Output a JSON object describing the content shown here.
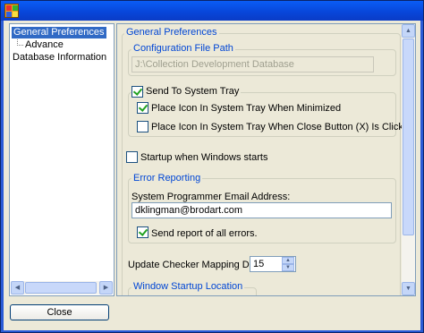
{
  "window": {
    "title": ""
  },
  "tree": {
    "items": [
      "General Preferences",
      "Advance",
      "Database Information"
    ]
  },
  "buttons": {
    "close": "Close"
  },
  "general": {
    "group_title": "General Preferences",
    "config": {
      "title": "Configuration File Path",
      "value": "J:\\Collection Development Database"
    },
    "tray": {
      "label": "Send To System Tray",
      "checked": true,
      "minimized_label": "Place Icon In System Tray When Minimized",
      "minimized_checked": true,
      "close_label": "Place Icon In System Tray When Close Button (X) Is Clicked",
      "close_checked": false
    },
    "startup": {
      "label": "Startup when Windows starts",
      "checked": false
    },
    "error": {
      "title": "Error Reporting",
      "email_label": "System Programmer Email Address:",
      "email_value": "dklingman@brodart.com",
      "send_label": "Send report of all errors.",
      "send_checked": true
    },
    "mapping": {
      "label": "Update Checker Mapping Delay:",
      "value": "15"
    },
    "startup_location": {
      "title": "Window Startup Location"
    }
  },
  "colors": {
    "titlebar": "#0a5df5",
    "accent": "#0046d5",
    "selection": "#316ac5",
    "face": "#ece9d8"
  }
}
